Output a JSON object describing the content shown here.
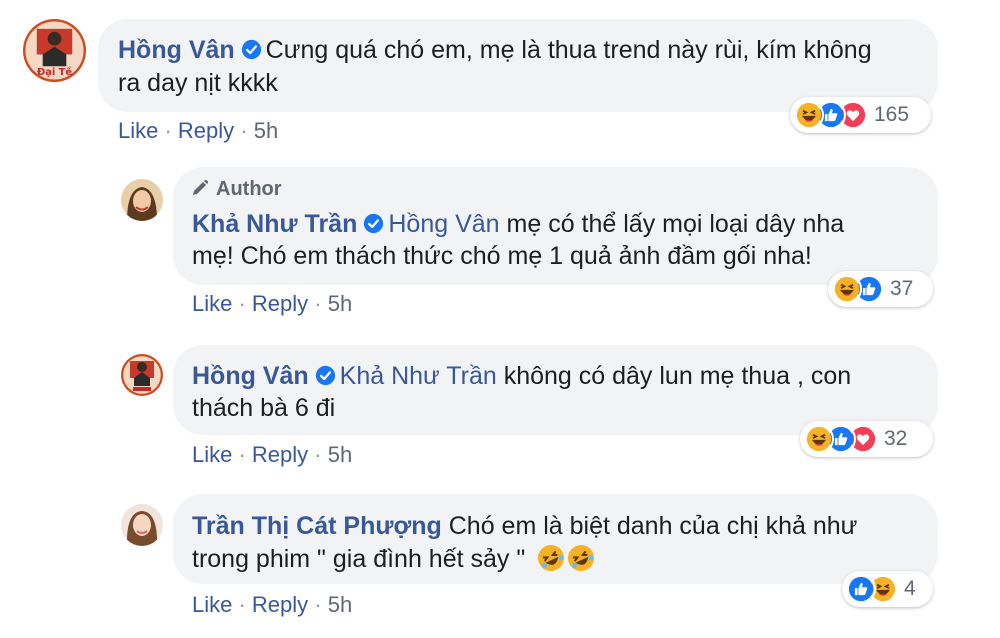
{
  "thread": {
    "comments": [
      {
        "author": "Hồng Vân",
        "verified": true,
        "lines": [
          "Cưng quá chó em, mẹ là thua trend này rùi, kím không",
          "ra day nịt kkkk"
        ],
        "actions": {
          "like": "Like",
          "reply": "Reply",
          "time": "5h"
        },
        "reactions": {
          "icons": [
            "haha-icon",
            "like-icon",
            "love-icon"
          ],
          "count": "165"
        },
        "avatar_caption": "Đại Tề"
      },
      {
        "author_badge": "Author",
        "author": "Khả Như Trần",
        "verified": true,
        "mention": "Hồng Vân",
        "lines": [
          "mẹ có thể lấy mọi loại dây nha",
          "mẹ! Chó em thách thức chó mẹ 1 quả ảnh đầm gối nha!"
        ],
        "actions": {
          "like": "Like",
          "reply": "Reply",
          "time": "5h"
        },
        "reactions": {
          "icons": [
            "haha-icon",
            "like-icon"
          ],
          "count": "37"
        }
      },
      {
        "author": "Hồng Vân",
        "verified": true,
        "mention": "Khả Như Trần",
        "lines": [
          "không có dây lun mẹ thua , con",
          "thách bà 6 đi"
        ],
        "actions": {
          "like": "Like",
          "reply": "Reply",
          "time": "5h"
        },
        "reactions": {
          "icons": [
            "haha-icon",
            "like-icon",
            "love-icon"
          ],
          "count": "32"
        }
      },
      {
        "author": "Trần Thị Cát Phượng",
        "verified": false,
        "lines": [
          "Chó em là biệt danh của chị khả như",
          "trong phim \" gia đình hết sảy \""
        ],
        "emoji": "rofl-emoji",
        "actions": {
          "like": "Like",
          "reply": "Reply",
          "time": "5h"
        },
        "reactions": {
          "icons": [
            "like-icon",
            "haha-icon"
          ],
          "count": "4"
        }
      }
    ]
  },
  "colors": {
    "link": "#385898",
    "bubble": "#f2f3f5",
    "meta": "#606770",
    "like": "#1877f2",
    "love": "#f33e58",
    "haha": "#f7b125"
  }
}
